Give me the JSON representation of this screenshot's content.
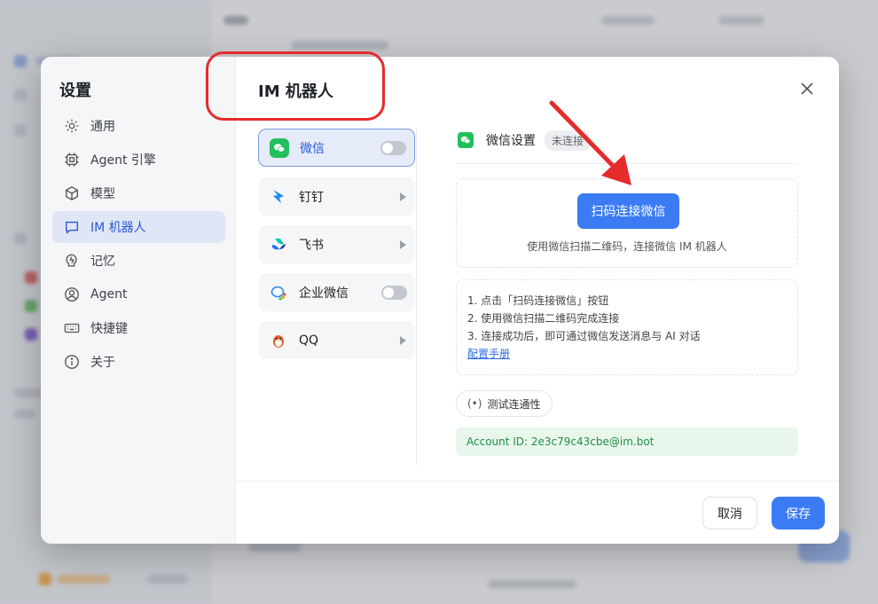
{
  "settings_dialog": {
    "nav_title": "设置",
    "nav_items": [
      {
        "label": "通用",
        "icon": "gear-icon"
      },
      {
        "label": "Agent 引擎",
        "icon": "cpu-chip-icon"
      },
      {
        "label": "模型",
        "icon": "cube-icon"
      },
      {
        "label": "IM 机器人",
        "icon": "chat-bubble-icon",
        "active": true
      },
      {
        "label": "记忆",
        "icon": "memory-icon"
      },
      {
        "label": "Agent",
        "icon": "user-icon"
      },
      {
        "label": "快捷键",
        "icon": "keyboard-icon"
      },
      {
        "label": "关于",
        "icon": "info-icon"
      }
    ],
    "page_title": "IM 机器人",
    "platforms": [
      {
        "label": "微信",
        "icon": "wechat-icon",
        "control": "toggle",
        "enabled": false,
        "active": true
      },
      {
        "label": "钉钉",
        "icon": "dingtalk-icon",
        "control": "arrow"
      },
      {
        "label": "飞书",
        "icon": "feishu-icon",
        "control": "arrow"
      },
      {
        "label": "企业微信",
        "icon": "wecom-icon",
        "control": "toggle",
        "enabled": false
      },
      {
        "label": "QQ",
        "icon": "qq-penguin-icon",
        "control": "arrow"
      }
    ],
    "wechat_panel": {
      "title": "微信设置",
      "status": "未连接",
      "scan_button": "扫码连接微信",
      "scan_hint": "使用微信扫描二维码，连接微信 IM 机器人",
      "steps": [
        "1. 点击「扫码连接微信」按钮",
        "2. 使用微信扫描二维码完成连接",
        "3. 连接成功后，即可通过微信发送消息与 AI 对话"
      ],
      "manual_link": "配置手册",
      "test_button": "测试连通性",
      "account_id": "Account ID: 2e3c79c43cbe@im.bot"
    },
    "footer": {
      "cancel": "取消",
      "save": "保存"
    }
  },
  "colors": {
    "primary": "#3b7cf4",
    "active_nav_bg": "#dfe6f6",
    "wechat_green": "#22c05c",
    "annotation_red": "#e52b2b",
    "account_bg": "#e8f6ec"
  }
}
